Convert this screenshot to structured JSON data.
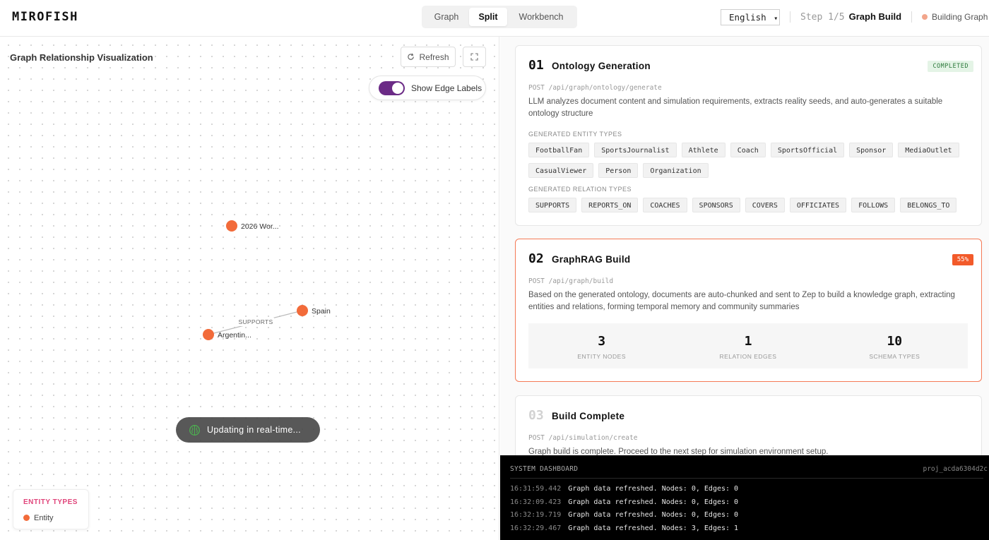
{
  "header": {
    "brand": "MIROFISH",
    "view_tabs": [
      {
        "label": "Graph",
        "active": false
      },
      {
        "label": "Split",
        "active": true
      },
      {
        "label": "Workbench",
        "active": false
      }
    ],
    "language": "English",
    "language_caret": "▾",
    "step_num": "Step 1/5",
    "step_name": "Graph Build",
    "status": "Building Graph",
    "status_color": "#f2a58b"
  },
  "graph_panel": {
    "title": "Graph Relationship Visualization",
    "refresh_label": "Refresh",
    "edge_labels_toggle": "Show Edge Labels",
    "edge_labels_on": true,
    "nodes": [
      {
        "label": "2026 Wor..."
      },
      {
        "label": "Spain"
      },
      {
        "label": "Argentin..."
      }
    ],
    "edges": [
      {
        "label": "SUPPORTS"
      }
    ],
    "realtime_text": "Updating in real-time...",
    "legend_title": "ENTITY TYPES",
    "legend_item": "Entity",
    "node_color": "#f26b3a",
    "accent_color": "#6b2b86"
  },
  "cards": {
    "ontology": {
      "num": "01",
      "title": "Ontology Generation",
      "badge": "COMPLETED",
      "endpoint": "POST /api/graph/ontology/generate",
      "description": "LLM analyzes document content and simulation requirements, extracts reality seeds, and auto-generates a suitable ontology structure",
      "entity_types_label": "GENERATED ENTITY TYPES",
      "entity_types": [
        "FootballFan",
        "SportsJournalist",
        "Athlete",
        "Coach",
        "SportsOfficial",
        "Sponsor",
        "MediaOutlet",
        "CasualViewer",
        "Person",
        "Organization"
      ],
      "relation_types_label": "GENERATED RELATION TYPES",
      "relation_types": [
        "SUPPORTS",
        "REPORTS_ON",
        "COACHES",
        "SPONSORS",
        "COVERS",
        "OFFICIATES",
        "FOLLOWS",
        "BELONGS_TO"
      ]
    },
    "graphrag": {
      "num": "02",
      "title": "GraphRAG Build",
      "badge": "55%",
      "progress_percent": 55,
      "endpoint": "POST /api/graph/build",
      "description": "Based on the generated ontology, documents are auto-chunked and sent to Zep to build a knowledge graph, extracting entities and relations, forming temporal memory and community summaries",
      "stats": [
        {
          "value": "3",
          "label": "ENTITY NODES"
        },
        {
          "value": "1",
          "label": "RELATION EDGES"
        },
        {
          "value": "10",
          "label": "SCHEMA TYPES"
        }
      ]
    },
    "complete": {
      "num": "03",
      "title": "Build Complete",
      "endpoint": "POST /api/simulation/create",
      "description": "Graph build is complete. Proceed to the next step for simulation environment setup."
    }
  },
  "dashboard": {
    "title": "SYSTEM DASHBOARD",
    "project": "proj_acda6304d2c",
    "logs": [
      {
        "time": "16:31:59.442",
        "message": "Graph data refreshed. Nodes: 0, Edges: 0"
      },
      {
        "time": "16:32:09.423",
        "message": "Graph data refreshed. Nodes: 0, Edges: 0"
      },
      {
        "time": "16:32:19.719",
        "message": "Graph data refreshed. Nodes: 0, Edges: 0"
      },
      {
        "time": "16:32:29.467",
        "message": "Graph data refreshed. Nodes: 3, Edges: 1"
      }
    ]
  }
}
